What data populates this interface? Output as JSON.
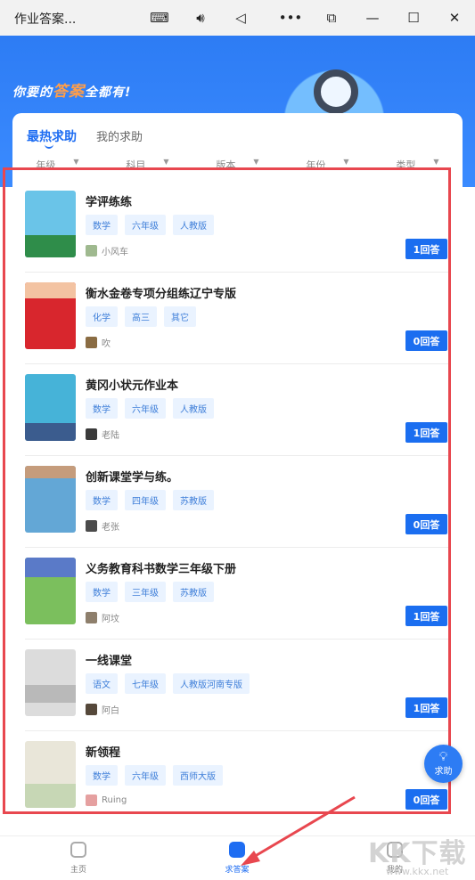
{
  "window": {
    "title": "作业答案...",
    "controls": [
      "keyboard-icon",
      "volume-icon",
      "back-icon",
      "more-icon",
      "snap-icon",
      "minimize-icon",
      "maximize-icon",
      "close-icon"
    ]
  },
  "hero": {
    "slogan_a": "你要的",
    "slogan_b": "答案",
    "slogan_c": "全都有!"
  },
  "tabs": [
    {
      "label": "最热求助",
      "active": true
    },
    {
      "label": "我的求助",
      "active": false
    }
  ],
  "filters": [
    "年级",
    "科目",
    "版本",
    "年份",
    "类型"
  ],
  "items": [
    {
      "title": "学评练练",
      "tags": [
        "数学",
        "六年级",
        "人教版"
      ],
      "user": "小风车",
      "answers": "1回答",
      "cover_color": "#6ac4e8"
    },
    {
      "title": "衡水金卷专项分组练辽宁专版",
      "tags": [
        "化学",
        "高三",
        "其它"
      ],
      "user": "吹",
      "answers": "0回答",
      "cover_color": "#d8262d"
    },
    {
      "title": "黄冈小状元作业本",
      "tags": [
        "数学",
        "六年级",
        "人教版"
      ],
      "user": "老陆",
      "answers": "1回答",
      "cover_color": "#46b3d8"
    },
    {
      "title": "创新课堂学与练。",
      "tags": [
        "数学",
        "四年级",
        "苏教版"
      ],
      "user": "老张",
      "answers": "0回答",
      "cover_color": "#63a7d6"
    },
    {
      "title": "义务教育科书数学三年级下册",
      "tags": [
        "数学",
        "三年级",
        "苏教版"
      ],
      "user": "阿坟",
      "answers": "1回答",
      "cover_color": "#7bbf5d"
    },
    {
      "title": "一线课堂",
      "tags": [
        "语文",
        "七年级",
        "人教版河南专版"
      ],
      "user": "阿白",
      "answers": "1回答",
      "cover_color": "#dcdcdc"
    },
    {
      "title": "新领程",
      "tags": [
        "数学",
        "六年级",
        "西师大版"
      ],
      "user": "Ruing",
      "answers": "0回答",
      "cover_color": "#e9e6d9"
    }
  ],
  "fab": {
    "label": "求助"
  },
  "nav": [
    {
      "label": "主页",
      "active": false
    },
    {
      "label": "求答案",
      "active": true
    },
    {
      "label": "我的",
      "active": false
    }
  ],
  "watermark": {
    "text": "KK下载",
    "url": "www.kkx.net"
  },
  "colors": {
    "accent": "#1e6df2",
    "highlight_box": "#e8474f"
  }
}
